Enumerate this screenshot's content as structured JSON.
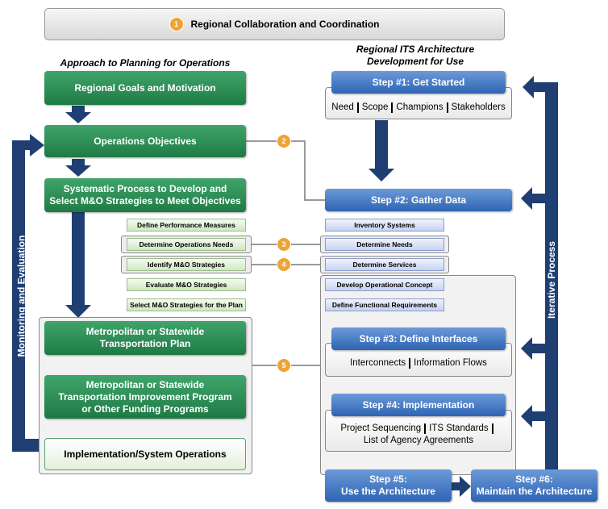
{
  "banner": {
    "badge": "1",
    "title": "Regional Collaboration and Coordination"
  },
  "left": {
    "header": "Approach to Planning for Operations",
    "goals": "Regional Goals and Motivation",
    "objectives": "Operations Objectives",
    "systematic": [
      "Systematic Process to Develop and",
      "Select M&O Strategies to Meet Objectives"
    ],
    "substeps": [
      "Define Performance Measures",
      "Determine Operations Needs",
      "Identify M&O Strategies",
      "Evaluate M&O Strategies",
      "Select M&O Strategies for the Plan"
    ],
    "plan": [
      "Metropolitan or Statewide",
      "Transportation Plan"
    ],
    "tip": [
      "Metropolitan or Statewide",
      "Transportation Improvement Program",
      "or Other Funding Programs"
    ],
    "implementation": "Implementation/System Operations",
    "loop_label": "Monitoring and Evaluation"
  },
  "right": {
    "header": [
      "Regional ITS Architecture",
      "Development for Use"
    ],
    "step1": {
      "title": "Step #1: Get Started",
      "items": [
        "Need",
        "Scope",
        "Champions",
        "Stakeholders"
      ]
    },
    "step2": {
      "title": "Step #2: Gather Data",
      "substeps": [
        "Inventory Systems",
        "Determine Needs",
        "Determine Services",
        "Develop Operational Concept",
        "Define Functional Requirements"
      ]
    },
    "step3": {
      "title": "Step #3: Define Interfaces",
      "items": [
        "Interconnects",
        "Information Flows"
      ]
    },
    "step4": {
      "title": "Step #4: Implementation",
      "items": [
        "Project Sequencing",
        "ITS Standards",
        "List of Agency Agreements"
      ]
    },
    "step5": [
      "Step #5:",
      "Use the Architecture"
    ],
    "step6": [
      "Step #6:",
      "Maintain the Architecture"
    ],
    "loop_label": "Iterative Process"
  },
  "badges": [
    "2",
    "3",
    "4",
    "5"
  ],
  "colors": {
    "green": "#1f7a45",
    "blue": "#2f64b3",
    "navy": "#1f3f73",
    "orange": "#f0a336"
  }
}
